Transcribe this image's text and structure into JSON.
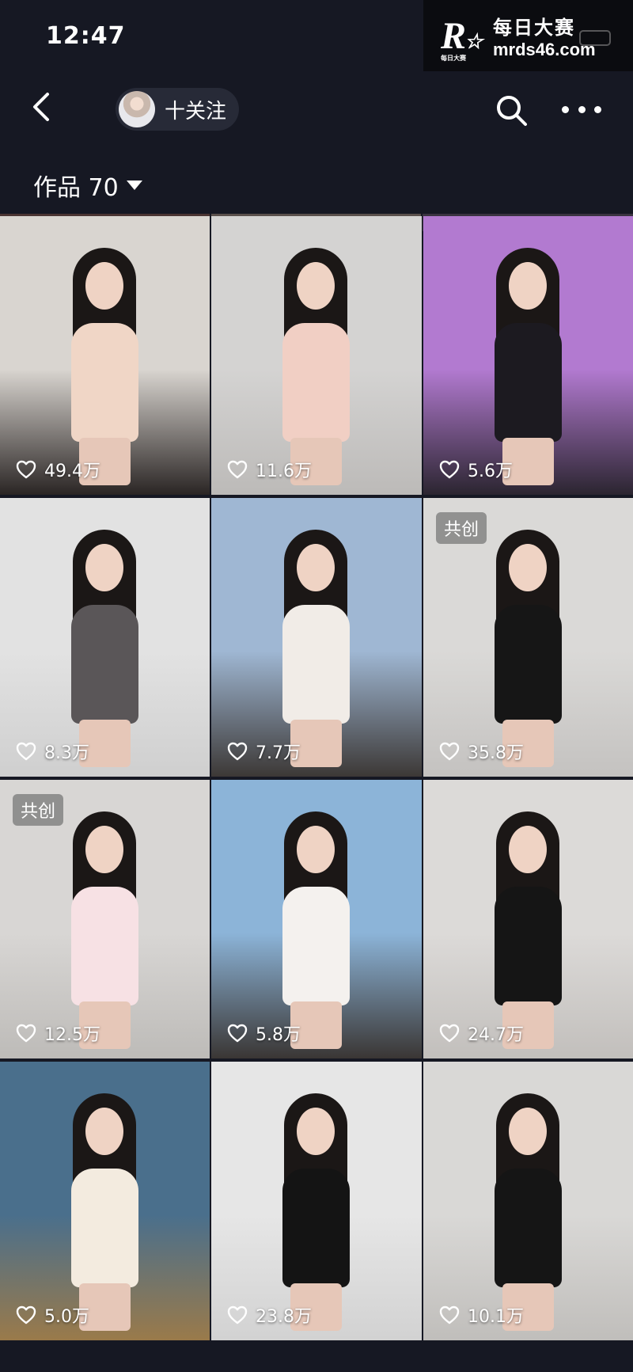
{
  "status": {
    "time": "12:47"
  },
  "watermark": {
    "logo": "R",
    "logo_sub": "每日大赛",
    "title": "每日大赛",
    "domain": "mrds46.com"
  },
  "header": {
    "follow_label": "十关注"
  },
  "tabs": {
    "works_label": "作品 70"
  },
  "grid": [
    {
      "likes": "49.4万",
      "badge": "",
      "bg": [
        "#d9d5d0",
        "#2a2524"
      ],
      "fig": "#f0d6c6"
    },
    {
      "likes": "11.6万",
      "badge": "",
      "bg": [
        "#d4d3d2",
        "#bcbab8"
      ],
      "fig": "#f1cfc4"
    },
    {
      "likes": "5.6万",
      "badge": "",
      "bg": [
        "#b27ad0",
        "#2b2530"
      ],
      "fig": "#1c1a20"
    },
    {
      "likes": "8.3万",
      "badge": "",
      "bg": [
        "#e2e2e2",
        "#cfcfcf"
      ],
      "fig": "#5a5658"
    },
    {
      "likes": "7.7万",
      "badge": "",
      "bg": [
        "#9fb7d3",
        "#3c3836"
      ],
      "fig": "#f1ece7"
    },
    {
      "likes": "35.8万",
      "badge": "共创",
      "bg": [
        "#dad9d7",
        "#c4c2c0"
      ],
      "fig": "#161616"
    },
    {
      "likes": "12.5万",
      "badge": "共创",
      "bg": [
        "#d8d6d4",
        "#bdbbb8"
      ],
      "fig": "#f7e1e4"
    },
    {
      "likes": "5.8万",
      "badge": "",
      "bg": [
        "#8cb4d8",
        "#3a3634"
      ],
      "fig": "#f4f1ee"
    },
    {
      "likes": "24.7万",
      "badge": "",
      "bg": [
        "#dcdad8",
        "#c2bfbc"
      ],
      "fig": "#151515"
    },
    {
      "likes": "5.0万",
      "badge": "",
      "bg": [
        "#4a6f8c",
        "#9a7a4a"
      ],
      "fig": "#f3ebdf"
    },
    {
      "likes": "23.8万",
      "badge": "",
      "bg": [
        "#e6e6e6",
        "#d2d2d2"
      ],
      "fig": "#141414"
    },
    {
      "likes": "10.1万",
      "badge": "",
      "bg": [
        "#d9d8d6",
        "#c0bebb"
      ],
      "fig": "#151515"
    }
  ]
}
